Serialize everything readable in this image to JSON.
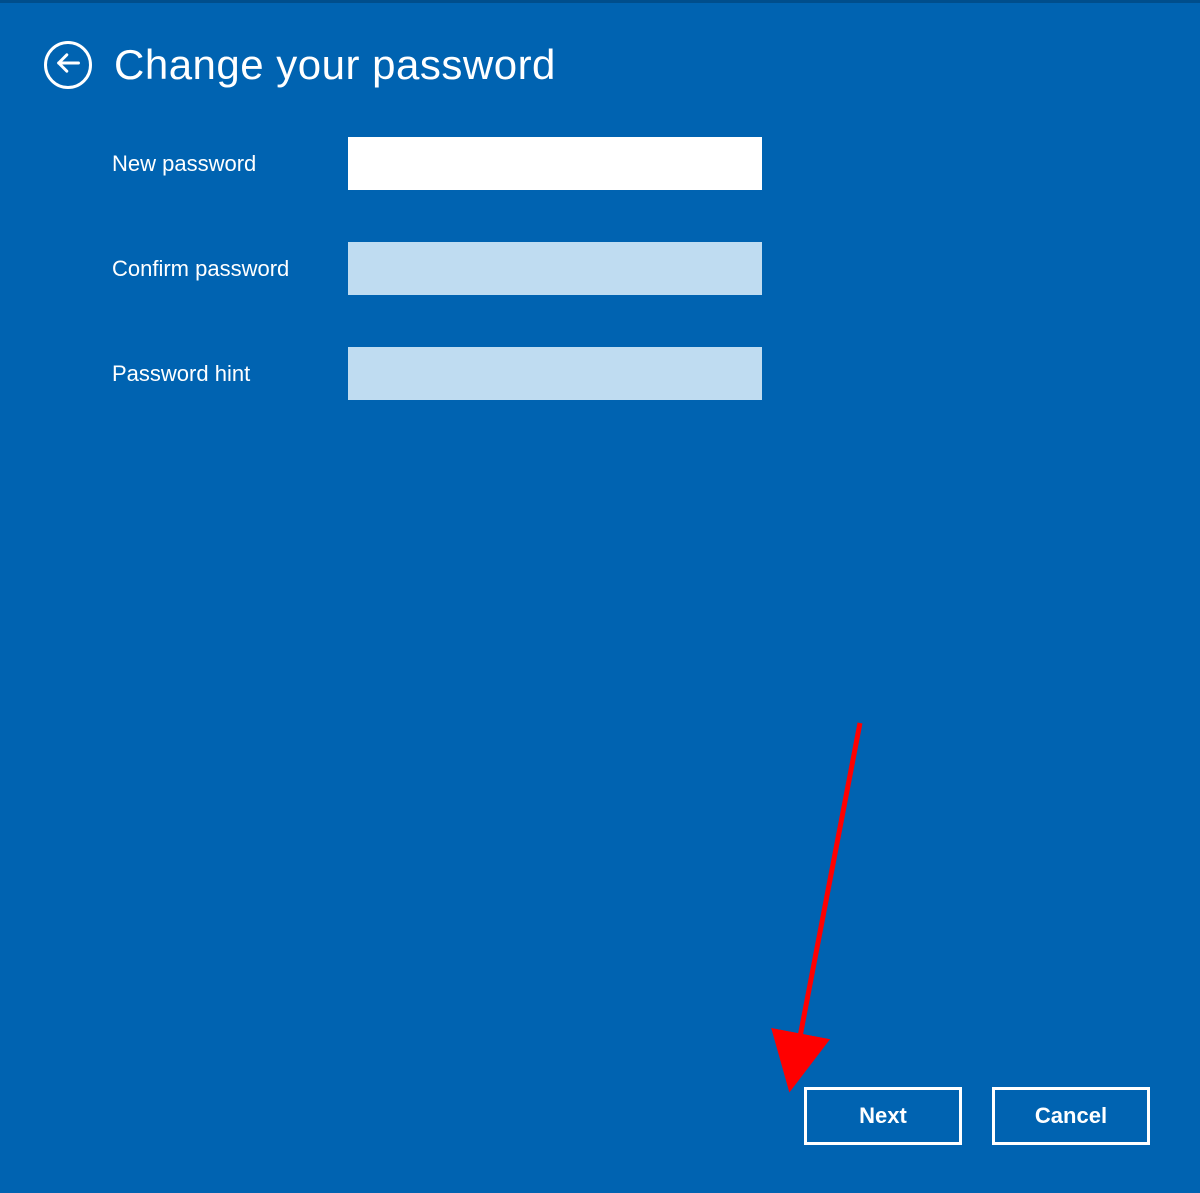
{
  "header": {
    "title": "Change your password"
  },
  "form": {
    "new_password": {
      "label": "New password",
      "value": ""
    },
    "confirm_password": {
      "label": "Confirm password",
      "value": ""
    },
    "password_hint": {
      "label": "Password hint",
      "value": ""
    }
  },
  "footer": {
    "next_label": "Next",
    "cancel_label": "Cancel"
  },
  "colors": {
    "background": "#0063b1",
    "input_inactive": "#bfdcf1",
    "input_active": "#ffffff",
    "annotation_arrow": "#ff0000"
  }
}
